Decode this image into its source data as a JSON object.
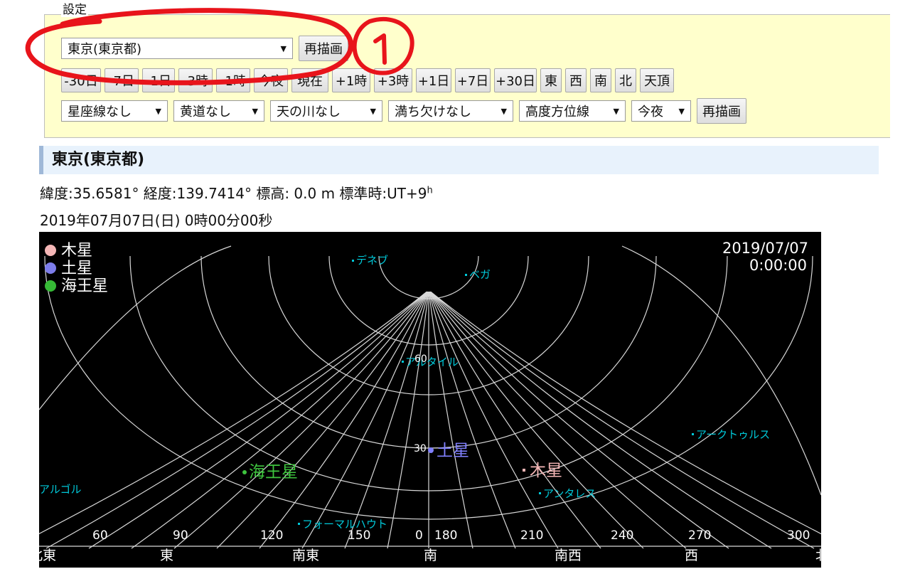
{
  "settings": {
    "legend": "設定",
    "location_value": "東京(東京都)",
    "redraw_label": "再描画",
    "time_buttons": [
      "-30日",
      "-7日",
      "-1日",
      "-3時",
      "-1時",
      "今夜",
      "現在",
      "+1時",
      "+3時",
      "+1日",
      "+7日",
      "+30日",
      "東",
      "西",
      "南",
      "北",
      "天頂"
    ],
    "options": [
      {
        "label": "星座線なし"
      },
      {
        "label": "黄道なし"
      },
      {
        "label": "天の川なし"
      },
      {
        "label": "満ち欠けなし"
      },
      {
        "label": "高度方位線"
      },
      {
        "label": "今夜"
      }
    ],
    "redraw2_label": "再描画"
  },
  "location": {
    "title": "東京(東京都)",
    "lat_prefix": "緯度:35.6581° 経度:139.7414° 標高: 0.0 m 標準時:UT+9",
    "tz_sup": "h",
    "datetime": "2019年07月07日(日) 0時00分00秒"
  },
  "chart": {
    "timestamp_date": "2019/07/07",
    "timestamp_time": "0:00:00",
    "legend": [
      {
        "name": "木星",
        "color": "#f4b6b6"
      },
      {
        "name": "土星",
        "color": "#7d7dea"
      },
      {
        "name": "海王星",
        "color": "#36b936"
      }
    ],
    "planets": [
      {
        "name": "土星",
        "color": "#8080ff"
      },
      {
        "name": "木星",
        "color": "#f4b6b6"
      },
      {
        "name": "海王星",
        "color": "#3ec43e"
      }
    ],
    "stars": [
      "デネブ",
      "ベガ",
      "アルタイル",
      "アークトゥルス",
      "アンタレス",
      "フォーマルハウト",
      "アルゴル"
    ],
    "star_color": "#00c8d8",
    "altitude_labels": [
      "60",
      "30"
    ],
    "azimuth_labels": [
      "60",
      "90",
      "120",
      "150",
      "0",
      "180",
      "210",
      "240",
      "270",
      "300"
    ],
    "direction_labels": [
      "北東",
      "東",
      "南東",
      "南",
      "南西",
      "西",
      "北"
    ]
  },
  "annotation": {
    "number": "①",
    "color": "#e8141b"
  }
}
